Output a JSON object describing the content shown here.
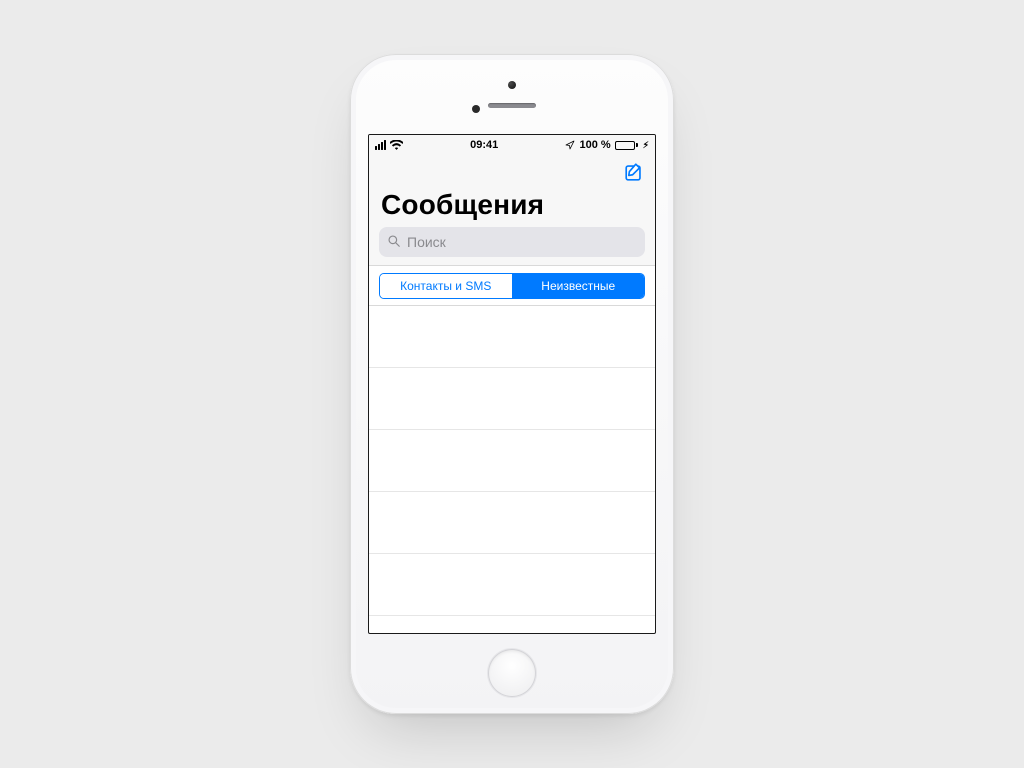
{
  "status": {
    "time": "09:41",
    "battery_text": "100 %"
  },
  "nav": {
    "title": "Сообщения"
  },
  "search": {
    "placeholder": "Поиск",
    "value": ""
  },
  "segments": {
    "contacts": "Контакты и SMS",
    "unknown": "Неизвестные",
    "active": "unknown"
  },
  "colors": {
    "accent": "#007aff",
    "battery_ok": "#35c759"
  },
  "list": {
    "rows": 6
  }
}
